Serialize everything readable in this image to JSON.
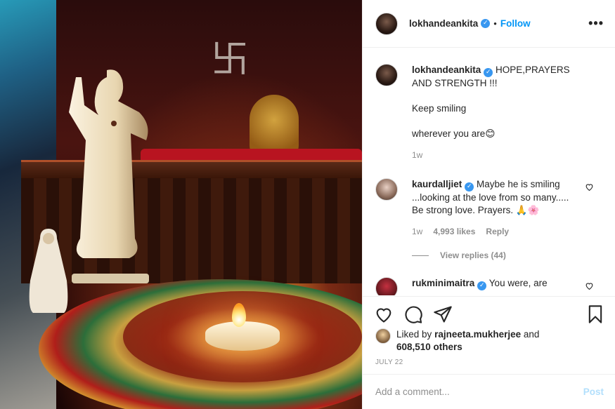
{
  "post": {
    "username": "lokhandeankita",
    "verified_glyph": "✓",
    "follow_label": "Follow",
    "dot": "•",
    "more_label": "•••"
  },
  "caption": {
    "username": "lokhandeankita",
    "text_line1": "HOPE,PRAYERS AND STRENGTH !!!",
    "text_line2": "Keep smiling",
    "text_line3": "wherever you are",
    "emoji": "😊",
    "time": "1w"
  },
  "comments": [
    {
      "username": "kaurdalljiet",
      "text": "Maybe he is smiling ...looking at the love from so many..... Be strong love. Prayers.",
      "emoji": "🙏🌸",
      "time": "1w",
      "likes": "4,993 likes",
      "reply_label": "Reply",
      "view_replies": "View replies (44)"
    },
    {
      "username": "rukminimaitra",
      "text": "You were, are"
    }
  ],
  "likes": {
    "prefix": "Liked by",
    "user": "rajneeta.mukherjee",
    "and": "and",
    "others": "608,510 others"
  },
  "date": "JULY 22",
  "add_comment": {
    "placeholder": "Add a comment...",
    "post_label": "Post"
  },
  "colors": {
    "accent": "#0095f6",
    "post_disabled": "#b2dffc",
    "verified": "#3897f0",
    "muted": "#8e8e8e"
  },
  "icons": [
    "heart-icon",
    "comment-icon",
    "share-icon",
    "bookmark-icon",
    "more-icon",
    "verified-icon"
  ]
}
